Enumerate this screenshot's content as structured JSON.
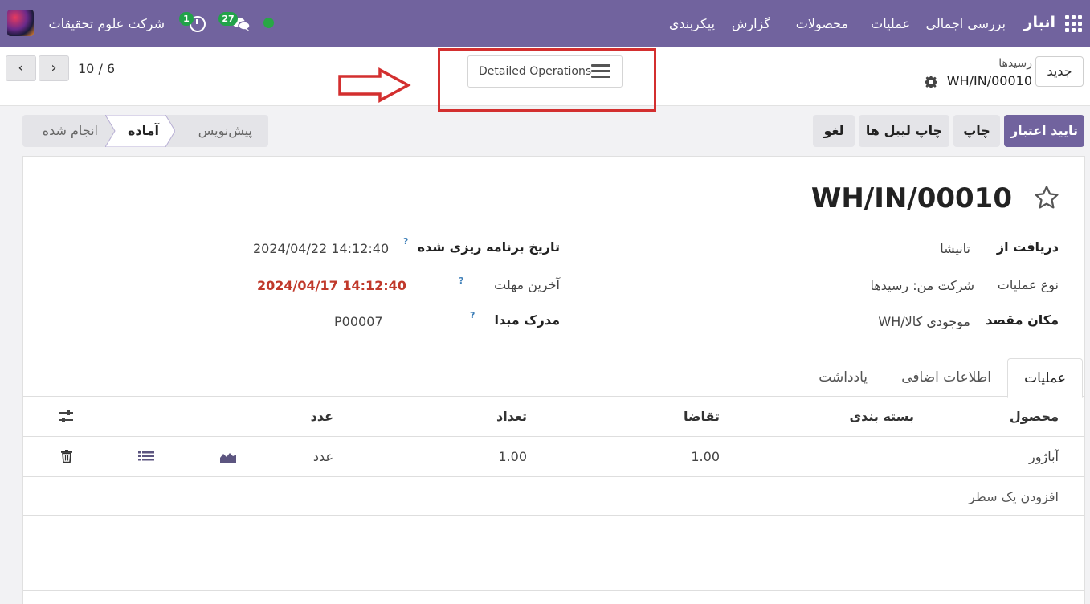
{
  "navbar": {
    "app_name": "انبار",
    "menu": [
      "بررسی اجمالی",
      "عملیات",
      "محصولات",
      "گزارش",
      "پیکربندی"
    ],
    "company": "شرکت علوم تحقیقات",
    "messages_count": "27",
    "activities_count": "1",
    "status_color": "#28a745"
  },
  "control": {
    "new_label": "جدید",
    "breadcrumb_parent": "رسیدها",
    "breadcrumb_current": "WH/IN/00010",
    "detailed_operations_label": "Detailed Operations",
    "pager": "10 / 6"
  },
  "actions": {
    "validate": "تایید اعتبار",
    "print": "چاپ",
    "print_labels": "چاپ لیبل ها",
    "cancel": "لغو"
  },
  "status": {
    "stages": [
      "پیش‌نویس",
      "آماده",
      "انجام شده"
    ],
    "active": "آماده"
  },
  "record": {
    "title": "WH/IN/00010",
    "receive_from_label": "دریافت از",
    "receive_from": "تانیشا",
    "operation_type_label": "نوع عملیات",
    "operation_type": "شرکت من: رسیدها",
    "destination_label": "مکان مقصد",
    "destination": "WH/موجودی کالا",
    "scheduled_date_label": "تاریخ برنامه ریزی شده",
    "scheduled_date": "2024/04/22 14:12:40",
    "deadline_label": "آخرین مهلت",
    "deadline": "2024/04/17 14:12:40",
    "source_document_label": "مدرک مبدا",
    "source_document": "P00007",
    "help_mark": "?"
  },
  "tabs": [
    "عملیات",
    "اطلاعات اضافی",
    "یادداشت"
  ],
  "table": {
    "columns": [
      "محصول",
      "بسته بندی",
      "تقاضا",
      "تعداد",
      "عدد"
    ],
    "rows": [
      {
        "product": "آباژور",
        "packaging": "",
        "demand": "1.00",
        "quantity": "1.00",
        "uom": "عدد"
      }
    ],
    "add_line": "افزودن یک سطر"
  },
  "colors": {
    "brand": "#71639e",
    "highlight_box": "#d32f2f",
    "deadline": "#c0392b"
  }
}
